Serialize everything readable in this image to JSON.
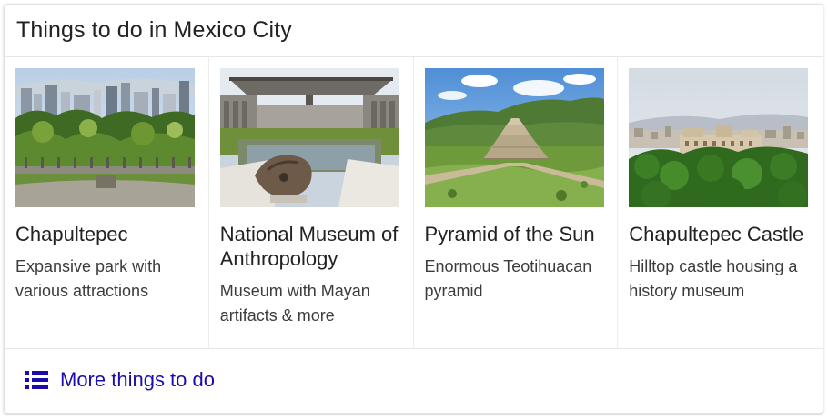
{
  "card": {
    "title": "Things to do in Mexico City"
  },
  "items": [
    {
      "title": "Chapultepec",
      "description": "Expansive park with various attractions",
      "image_icon": "park-photo"
    },
    {
      "title": "National Museum of Anthropology",
      "description": "Museum with Mayan artifacts & more",
      "image_icon": "museum-photo"
    },
    {
      "title": "Pyramid of the Sun",
      "description": "Enormous Teotihuacan pyramid",
      "image_icon": "pyramid-photo"
    },
    {
      "title": "Chapultepec Castle",
      "description": "Hilltop castle housing a history museum",
      "image_icon": "castle-photo"
    }
  ],
  "footer": {
    "more_label": "More things to do",
    "more_icon": "list-icon"
  },
  "colors": {
    "link": "#1a0dab",
    "title_text": "#222222",
    "border": "#dfe1e5"
  }
}
